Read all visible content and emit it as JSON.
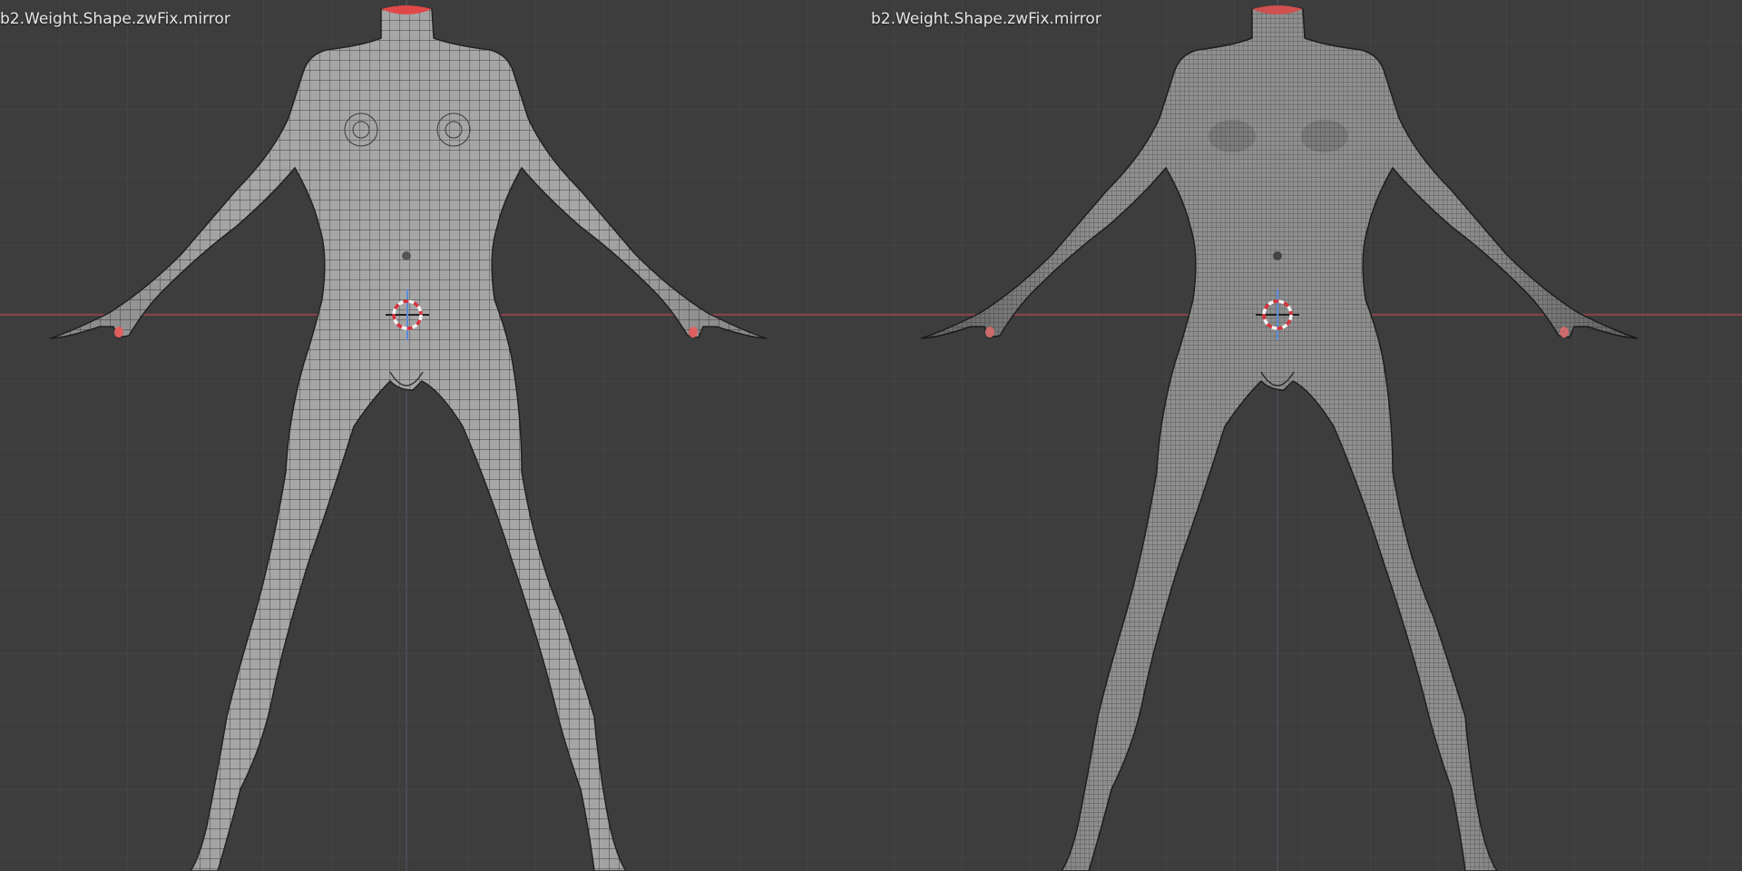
{
  "viewports": [
    {
      "object_name": "b2.Weight.Shape.zwFix.mirror",
      "mesh_density": "low",
      "shading": "wireframe-overlay"
    },
    {
      "object_name": "b2.Weight.Shape.zwFix.mirror",
      "mesh_density": "high",
      "shading": "wireframe-overlay"
    }
  ],
  "colors": {
    "background": "#3d3d3d",
    "grid_line": "#484848",
    "x_axis": "#a3454f",
    "z_axis": "#5a8ad8",
    "mesh_surface": "#a9a9a9",
    "mesh_wire": "#2a2a2a",
    "selection_highlight": "#e04848",
    "cursor_red": "#d8323c",
    "cursor_white": "#f2f2f2"
  },
  "icons": {
    "cursor": "3d-cursor-icon"
  }
}
